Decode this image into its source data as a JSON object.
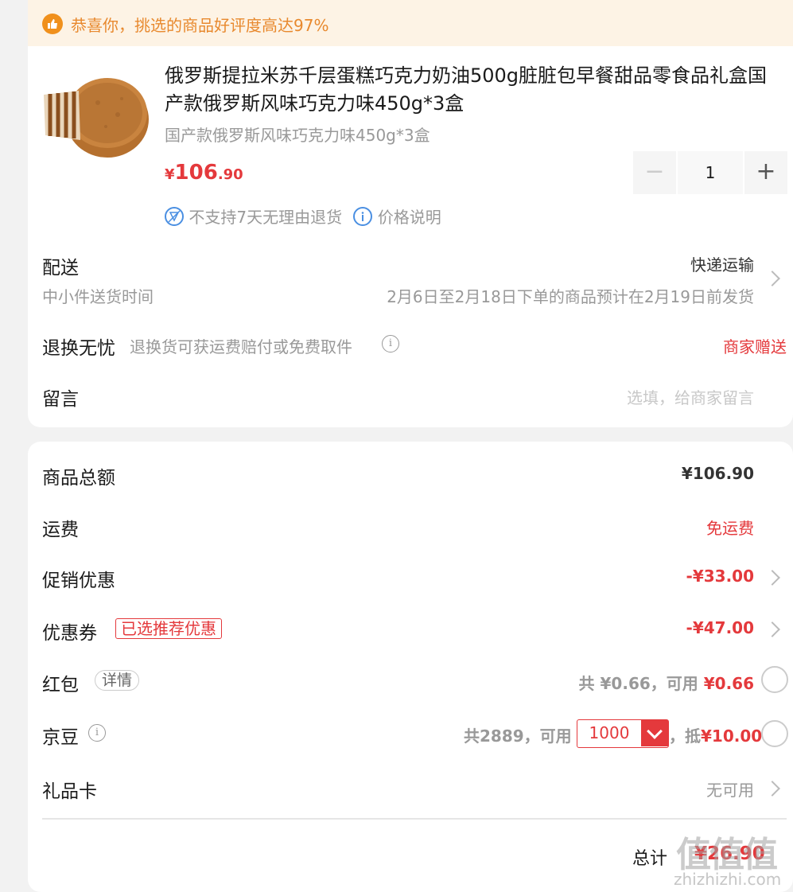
{
  "banner": {
    "text": "恭喜你，挑选的商品好评度高达97%",
    "icon": "thumbs-up-icon"
  },
  "product": {
    "title": "俄罗斯提拉米苏千层蛋糕巧克力奶油500g脏脏包早餐甜品零食品礼盒国产款俄罗斯风味巧克力味450g*3盒",
    "spec": "国产款俄罗斯风味巧克力味450g*3盒",
    "price_currency": "¥",
    "price_int": "106",
    "price_dec": ".90",
    "quantity": "1",
    "minus": "−",
    "plus": "+",
    "no_return": "不支持7天无理由退货",
    "price_info": "价格说明"
  },
  "delivery": {
    "label": "配送",
    "method": "快递运输",
    "sub": "中小件送货时间",
    "note": "2月6日至2月18日下单的商品预计在2月19日前发货"
  },
  "returns": {
    "label": "退换无忧",
    "desc": "退换货可获运费赔付或免费取件",
    "value": "商家赠送"
  },
  "message": {
    "label": "留言",
    "placeholder": "选填，给商家留言"
  },
  "summary": {
    "goods_total_label": "商品总额",
    "goods_total": "¥106.90",
    "shipping_label": "运费",
    "shipping": "免运费",
    "promo_label": "促销优惠",
    "promo": "-¥33.00",
    "coupon_label": "优惠券",
    "coupon_tag": "已选推荐优惠",
    "coupon": "-¥47.00",
    "redpacket_label": "红包",
    "redpacket_tag": "详情",
    "redpacket_total": "共 ¥0.66，可用 ",
    "redpacket_avail": "¥0.66",
    "bean_label": "京豆",
    "bean_total": "共2889，可用",
    "bean_select": "1000",
    "bean_deduct_prefix": "，抵",
    "bean_deduct": "¥10.00",
    "giftcard_label": "礼品卡",
    "giftcard": "无可用",
    "total_label": "总计",
    "total": "¥26.90"
  },
  "watermark": {
    "text": "值值值",
    "url": "zhizhizhi.com"
  },
  "colors": {
    "accent": "#e4393c",
    "banner_bg": "#fdf3e5",
    "banner_text": "#e8892e"
  }
}
